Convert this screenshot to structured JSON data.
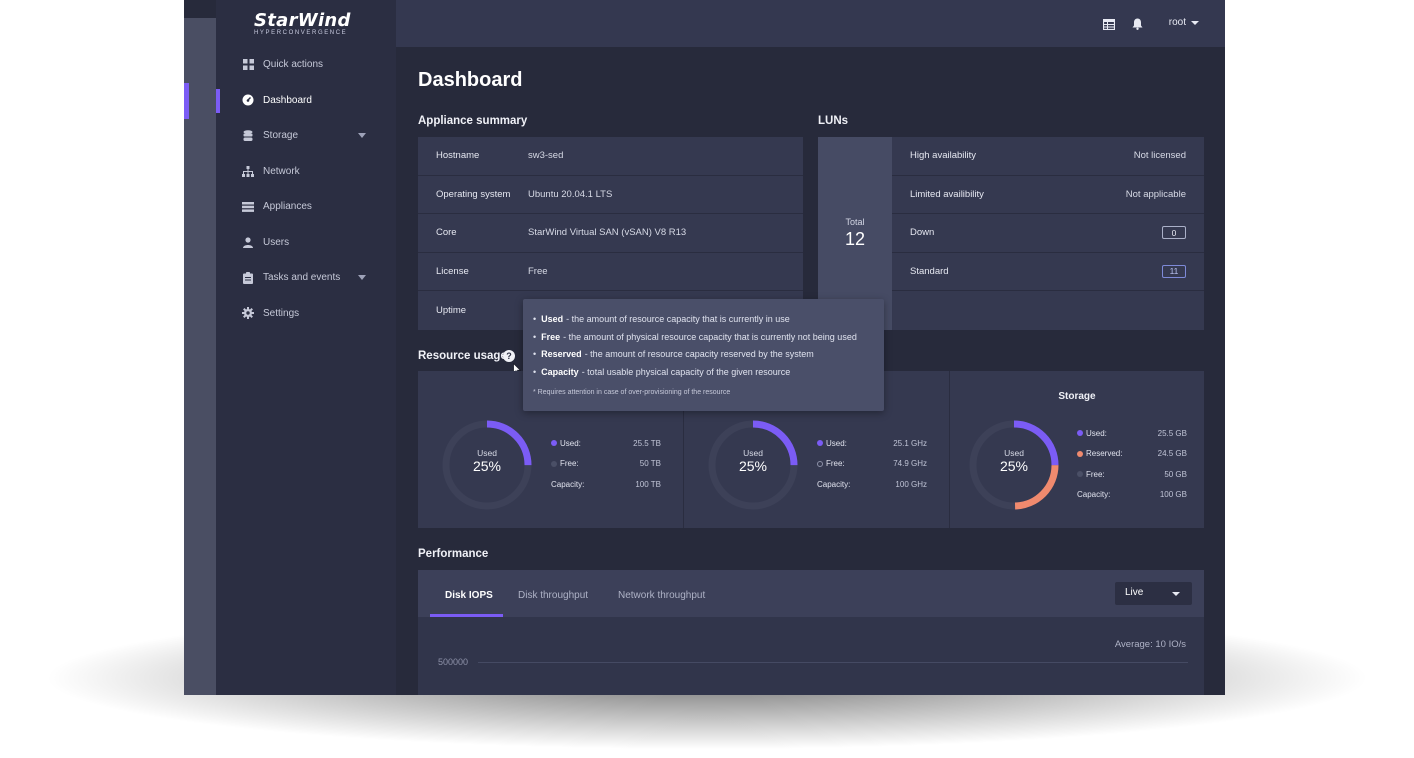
{
  "brand": {
    "name": "StarWind",
    "tagline": "HYPERCONVERGENCE"
  },
  "topbar": {
    "user": "root",
    "icons": [
      "table-icon",
      "bell-icon"
    ]
  },
  "sidebar": {
    "items": [
      {
        "label": "Quick actions",
        "icon": "grid-icon"
      },
      {
        "label": "Dashboard",
        "icon": "gauge-icon",
        "active": true
      },
      {
        "label": "Storage",
        "icon": "database-icon",
        "expandable": true
      },
      {
        "label": "Network",
        "icon": "network-icon"
      },
      {
        "label": "Appliances",
        "icon": "server-icon"
      },
      {
        "label": "Users",
        "icon": "user-icon"
      },
      {
        "label": "Tasks and events",
        "icon": "clipboard-icon",
        "expandable": true
      },
      {
        "label": "Settings",
        "icon": "gear-icon"
      }
    ]
  },
  "page": {
    "title": "Dashboard"
  },
  "appliance_summary": {
    "title": "Appliance summary",
    "rows": [
      {
        "key": "Hostname",
        "value": "sw3-sed"
      },
      {
        "key": "Operating system",
        "value": "Ubuntu 20.04.1 LTS"
      },
      {
        "key": "Core",
        "value": "StarWind Virtual SAN (vSAN) V8 R13"
      },
      {
        "key": "License",
        "value": "Free"
      },
      {
        "key": "Uptime",
        "value": ""
      }
    ]
  },
  "luns": {
    "title": "LUNs",
    "total_label": "Total",
    "total": "12",
    "rows": [
      {
        "label": "High availability",
        "value": "Not licensed"
      },
      {
        "label": "Limited availibility",
        "value": "Not applicable"
      },
      {
        "label": "Down",
        "value": "0"
      },
      {
        "label": "Standard",
        "value": "11"
      }
    ]
  },
  "resource_usage": {
    "title": "Resource usage",
    "panels": [
      {
        "title": "",
        "used_label": "Used",
        "percent": "25%",
        "used_fraction": 0.25,
        "legend": [
          {
            "label": "Used:",
            "value": "25.5 TB",
            "color": "#7b5cf5"
          },
          {
            "label": "Free:",
            "value": "50 TB",
            "color": "#4a4f66"
          },
          {
            "label": "Capacity:",
            "value": "100 TB"
          }
        ]
      },
      {
        "title": "",
        "used_label": "Used",
        "percent": "25%",
        "used_fraction": 0.25,
        "legend": [
          {
            "label": "Used:",
            "value": "25.1 GHz",
            "color": "#7b5cf5"
          },
          {
            "label": "Free:",
            "value": "74.9 GHz",
            "color": "#4a4f66"
          },
          {
            "label": "Capacity:",
            "value": "100 GHz"
          }
        ]
      },
      {
        "title": "Storage",
        "used_label": "Used",
        "percent": "25%",
        "used_fraction": 0.25,
        "reserved_fraction": 0.245,
        "legend": [
          {
            "label": "Used:",
            "value": "25.5 GB",
            "color": "#7b5cf5"
          },
          {
            "label": "Reserved:",
            "value": "24.5 GB",
            "color": "#f08a6e"
          },
          {
            "label": "Free:",
            "value": "50 GB",
            "color": "#4a4f66"
          },
          {
            "label": "Capacity:",
            "value": "100 GB"
          }
        ]
      }
    ]
  },
  "tooltip": {
    "lines": [
      {
        "term": "Used",
        "text": "- the amount of resource capacity that is currently in use"
      },
      {
        "term": "Free",
        "text": "- the amount of physical resource capacity that is currently not being used"
      },
      {
        "term": "Reserved",
        "text": "- the amount of resource capacity reserved by the system"
      },
      {
        "term": "Capacity",
        "text": "- total usable physical capacity of the given resource"
      }
    ],
    "note": "* Requires attention in case of over-provisioning of the resource"
  },
  "performance": {
    "title": "Performance",
    "tabs": [
      "Disk IOPS",
      "Disk throughput",
      "Network throughput"
    ],
    "active_tab": "Disk IOPS",
    "range": "Live",
    "average": "Average: 10 IO/s",
    "y_tick": "500000"
  },
  "colors": {
    "accent": "#7b5cf5",
    "reserved": "#f08a6e"
  }
}
